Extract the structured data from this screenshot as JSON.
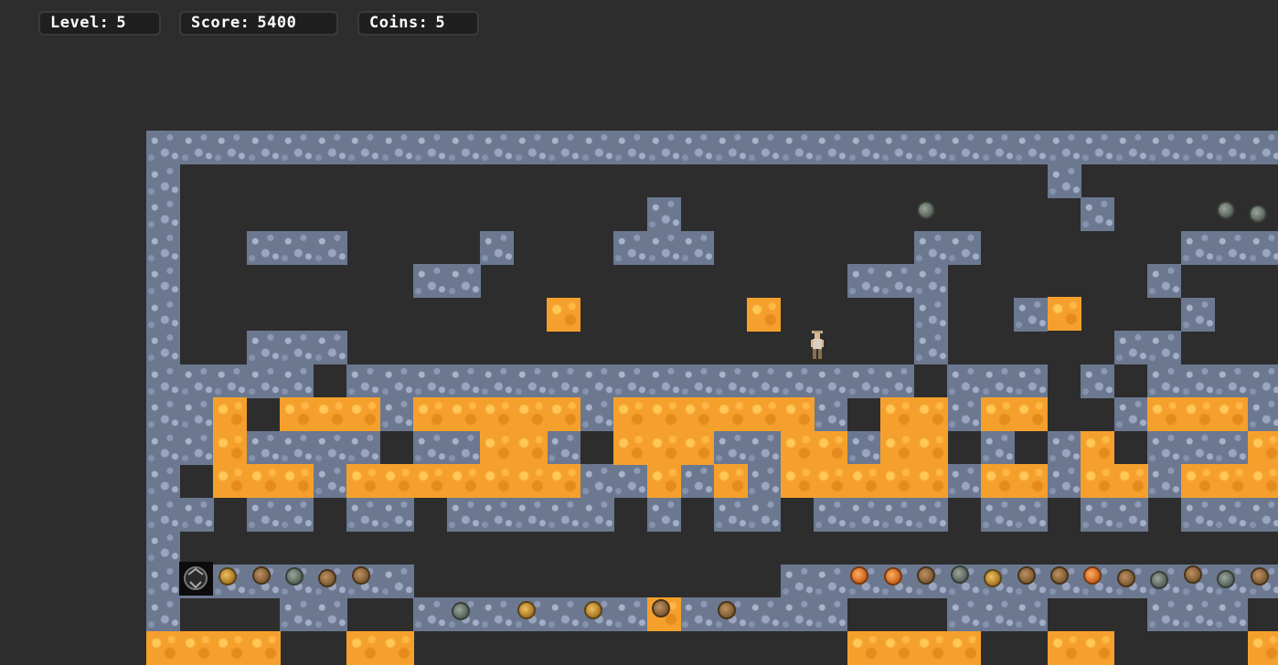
{
  "hud": {
    "level_label": "Level:",
    "level_value": "5",
    "score_label": "Score:",
    "score_value": "5400",
    "coins_label": "Coins:",
    "coins_value": "5"
  },
  "icons": {
    "player": "explorer-character-icon",
    "exit": "exit-door-icon",
    "coin": "coin-icon"
  },
  "colors": {
    "background": "#2d2d2d",
    "stone": "#6b7890",
    "lava": "#f5a02c",
    "hud_bg": "#1f1f1f",
    "hud_text": "#ffffff"
  }
}
